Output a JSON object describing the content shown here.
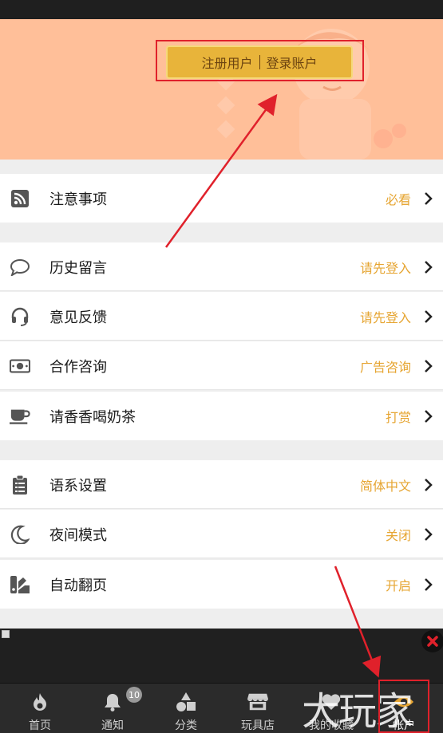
{
  "header": {
    "login_left": "注册用户",
    "login_right": "登录账户"
  },
  "menu": {
    "group1": [
      {
        "label": "注意事项",
        "value": "必看",
        "icon": "rss-icon"
      }
    ],
    "group2": [
      {
        "label": "历史留言",
        "value": "请先登入",
        "icon": "comment-bubble-icon"
      },
      {
        "label": "意见反馈",
        "value": "请先登入",
        "icon": "headset-icon"
      },
      {
        "label": "合作咨询",
        "value": "广告咨询",
        "icon": "money-bill-icon"
      },
      {
        "label": "请香香喝奶茶",
        "value": "打赏",
        "icon": "coffee-cup-icon"
      }
    ],
    "group3": [
      {
        "label": "语系设置",
        "value": "简体中文",
        "icon": "clipboard-list-icon"
      },
      {
        "label": "夜间模式",
        "value": "关闭",
        "icon": "moon-icon"
      },
      {
        "label": "自动翻页",
        "value": "开启",
        "icon": "swatchbook-icon"
      }
    ]
  },
  "tabs": [
    {
      "label": "首页",
      "icon": "flame-icon"
    },
    {
      "label": "通知",
      "icon": "bell-icon",
      "badge": "10"
    },
    {
      "label": "分类",
      "icon": "shapes-icon"
    },
    {
      "label": "玩具店",
      "icon": "store-icon"
    },
    {
      "label": "我的收藏",
      "icon": "heart-icon"
    },
    {
      "label": "帐户",
      "icon": "eye-icon"
    }
  ],
  "watermark": "大玩家",
  "colors": {
    "accent": "#e6a532",
    "header_bg": "#ffbf99",
    "login_button": "#e8b43a",
    "highlight_frame": "#e0212b",
    "tabbar_bg": "#2b2b2b"
  }
}
